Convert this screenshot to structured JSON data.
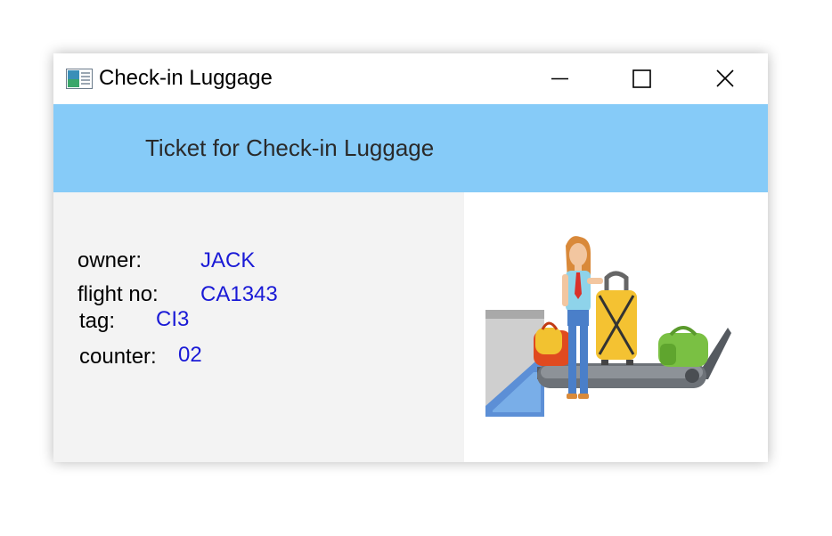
{
  "window": {
    "title": "Check-in Luggage",
    "app_icon": "window-app-icon",
    "controls": [
      "minimize-icon",
      "maximize-icon",
      "close-icon"
    ]
  },
  "banner": {
    "title": "Ticket for Check-in Luggage",
    "background": "#86cbf8"
  },
  "ticket": {
    "owner_label": "owner:",
    "owner_value": "JACK",
    "flight_label": "flight no:",
    "flight_value": "CA1343",
    "tag_label": "tag:",
    "tag_value": "CI3",
    "counter_label": "counter:",
    "counter_value": "02",
    "value_color": "#1a1ad6"
  },
  "illustration": {
    "icon": "luggage-conveyor-illustration"
  }
}
